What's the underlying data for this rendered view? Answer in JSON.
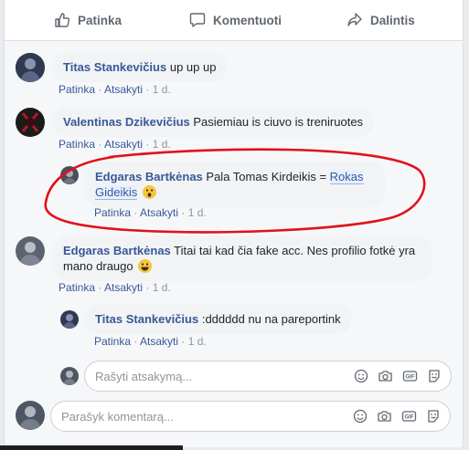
{
  "actions": {
    "like": "Patinka",
    "comment": "Komentuoti",
    "share": "Dalintis"
  },
  "comments": [
    {
      "name": "Titas Stankevičius",
      "text": "up up up",
      "like": "Patinka",
      "reply": "Atsakyti",
      "time": "1 d."
    },
    {
      "name": "Valentinas Dzikevičius",
      "text": "Pasiemiau is ciuvo is treniruotes",
      "like": "Patinka",
      "reply": "Atsakyti",
      "time": "1 d."
    },
    {
      "name": "Edgaras Bartkėnas",
      "text1": "Pala Tomas Kirdeikis = ",
      "tag1": "Rokas",
      "tag2": "Gideikis",
      "like": "Patinka",
      "reply": "Atsakyti",
      "time": "1 d."
    },
    {
      "name": "Edgaras Bartkėnas",
      "text1": "Titai tai kad čia fake acc. Nes profilio fotkė yra",
      "text2": "mano draugo",
      "like": "Patinka",
      "reply": "Atsakyti",
      "time": "1 d."
    },
    {
      "name": "Titas Stankevičius",
      "text": ":dddddd nu na pareportink",
      "like": "Patinka",
      "reply": "Atsakyti",
      "time": "1 d."
    }
  ],
  "reply_input": {
    "placeholder": "Rašyti atsakymą..."
  },
  "comment_input": {
    "placeholder": "Parašyk komentarą..."
  },
  "colors": {
    "link": "#385898",
    "annotation": "#e0121b",
    "bubble": "#f2f3f5"
  }
}
